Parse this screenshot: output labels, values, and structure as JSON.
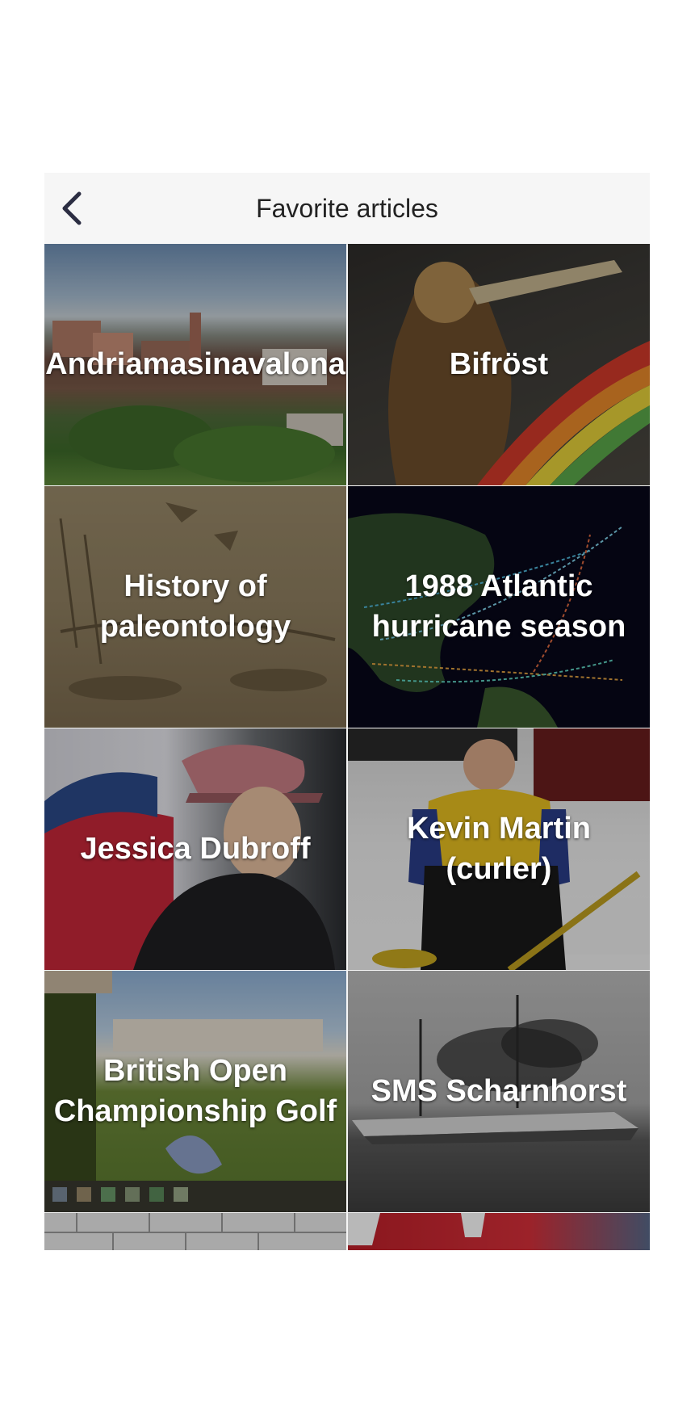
{
  "header": {
    "title": "Favorite articles",
    "back_icon": "chevron-left-icon"
  },
  "colors": {
    "header_bg": "#f6f6f6",
    "title_text": "#222222",
    "back_chevron": "#2b2d42",
    "tile_text": "#ffffff"
  },
  "articles": [
    {
      "title": "Andriamasinavalona"
    },
    {
      "title": "Bifröst"
    },
    {
      "title": "History of paleontology"
    },
    {
      "title": "1988 Atlantic hurricane season"
    },
    {
      "title": "Jessica Dubroff"
    },
    {
      "title": "Kevin Martin (curler)"
    },
    {
      "title": "British Open Championship Golf"
    },
    {
      "title": "SMS Scharnhorst"
    }
  ]
}
